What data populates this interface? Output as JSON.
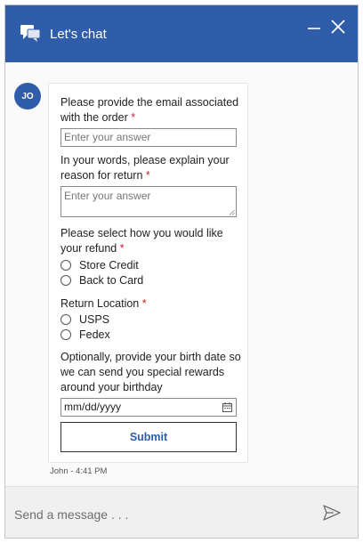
{
  "header": {
    "title": "Let's chat",
    "icons": [
      "chat-icon",
      "minimize-icon",
      "close-icon"
    ],
    "color": "#2f5daa"
  },
  "agent": {
    "initials": "JO"
  },
  "form": {
    "email": {
      "label": "Please provide the email associated with the order",
      "required_mark": "*",
      "placeholder": "Enter your answer"
    },
    "reason": {
      "label": "In your words, please explain your reason for return",
      "required_mark": "*",
      "placeholder": "Enter your answer"
    },
    "refund": {
      "label": "Please select how you would like your refund",
      "required_mark": "*",
      "options": [
        "Store Credit",
        "Back to Card"
      ]
    },
    "location": {
      "label": "Return Location",
      "required_mark": "*",
      "options": [
        "USPS",
        "Fedex"
      ]
    },
    "birthdate": {
      "label": "Optionally, provide your birth date so we can send you special rewards around your birthday",
      "value": "mm/dd/yyyy"
    },
    "submit_label": "Submit"
  },
  "timestamp": "John - 4:41 PM",
  "composer": {
    "placeholder": "Send a message . . ."
  }
}
